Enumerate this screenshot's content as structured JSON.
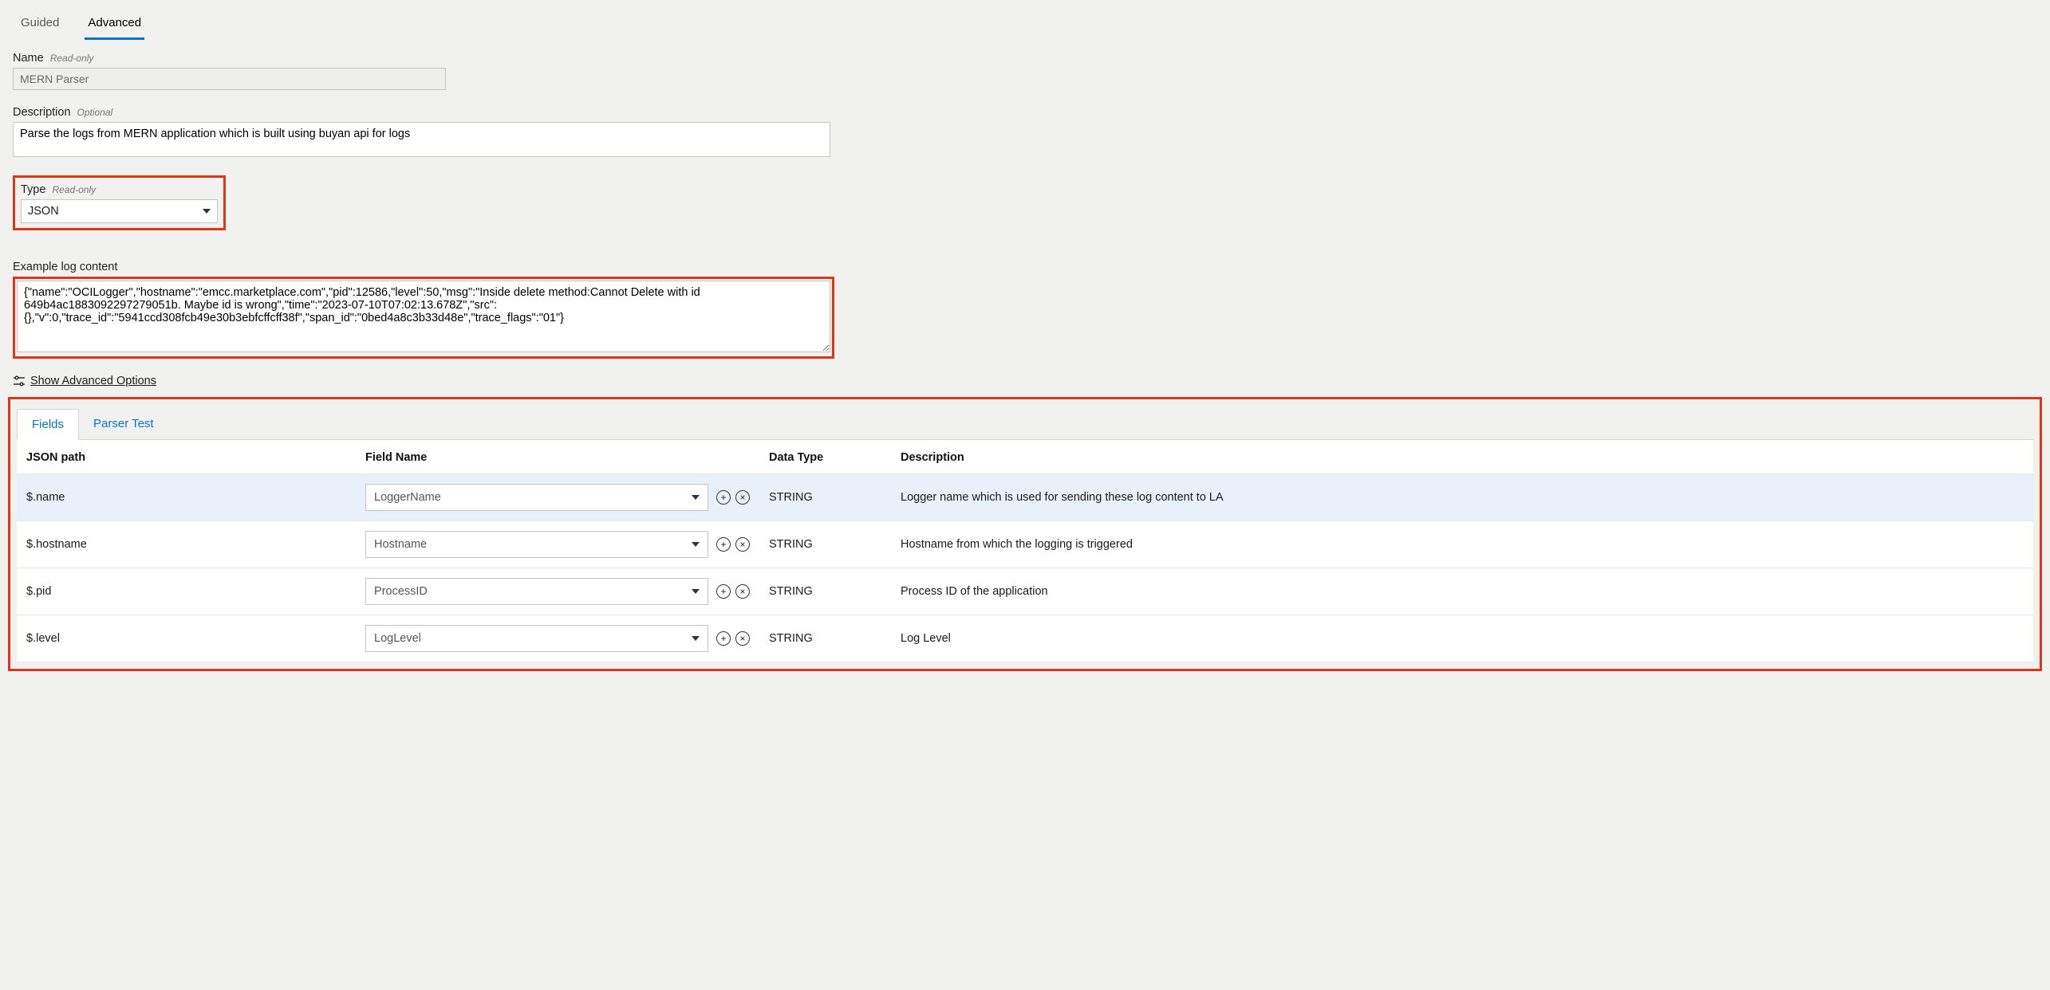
{
  "tabs": {
    "guided": "Guided",
    "advanced": "Advanced"
  },
  "name": {
    "label": "Name",
    "hint": "Read-only",
    "value": "MERN Parser"
  },
  "description": {
    "label": "Description",
    "hint": "Optional",
    "value": "Parse the logs from MERN application which is built using buyan api for logs"
  },
  "type": {
    "label": "Type",
    "hint": "Read-only",
    "value": "JSON"
  },
  "example": {
    "label": "Example log content",
    "value": "{\"name\":\"OCILogger\",\"hostname\":\"emcc.marketplace.com\",\"pid\":12586,\"level\":50,\"msg\":\"Inside delete method:Cannot Delete with id 649b4ac1883092297279051b. Maybe id is wrong\",\"time\":\"2023-07-10T07:02:13.678Z\",\"src\":{},\"v\":0,\"trace_id\":\"5941ccd308fcb49e30b3ebfcffcff38f\",\"span_id\":\"0bed4a8c3b33d48e\",\"trace_flags\":\"01\"}"
  },
  "advanced_link": "Show Advanced Options",
  "subtabs": {
    "fields": "Fields",
    "parser_test": "Parser Test"
  },
  "table": {
    "headers": {
      "json_path": "JSON path",
      "field_name": "Field Name",
      "data_type": "Data Type",
      "description": "Description"
    },
    "rows": [
      {
        "path": "$.name",
        "field": "LoggerName",
        "dtype": "STRING",
        "desc": "Logger name which is used for sending these log content to LA"
      },
      {
        "path": "$.hostname",
        "field": "Hostname",
        "dtype": "STRING",
        "desc": "Hostname from which the logging is triggered"
      },
      {
        "path": "$.pid",
        "field": "ProcessID",
        "dtype": "STRING",
        "desc": "Process ID of the application"
      },
      {
        "path": "$.level",
        "field": "LogLevel",
        "dtype": "STRING",
        "desc": "Log Level"
      }
    ]
  }
}
